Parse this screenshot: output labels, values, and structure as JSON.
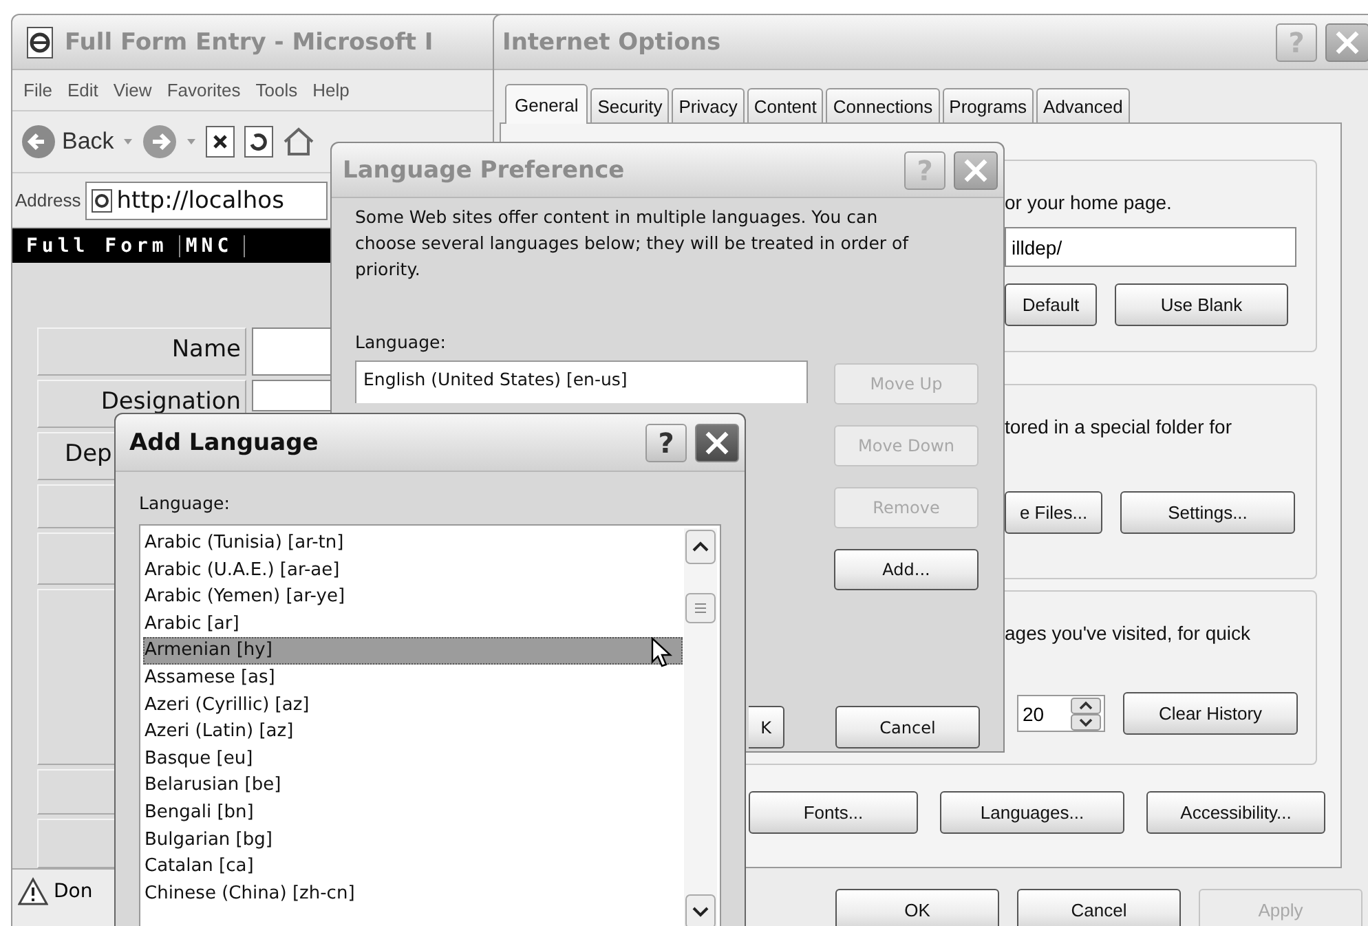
{
  "browser": {
    "title": "Full Form Entry - Microsoft I",
    "active": false,
    "menu": [
      "File",
      "Edit",
      "View",
      "Favorites",
      "Tools",
      "Help"
    ],
    "back_label": "Back",
    "address": {
      "label": "Address",
      "value": "http://localhos"
    },
    "nav": [
      "Full Form",
      "MNC"
    ],
    "form_labels": [
      {
        "label": "Name",
        "truncated": false
      },
      {
        "label": "Designation",
        "truncated": false
      },
      {
        "label": "Dep",
        "truncated": true
      }
    ],
    "status": "Don"
  },
  "internet_options": {
    "title": "Internet Options",
    "active": false,
    "help_button": "?",
    "tabs": [
      {
        "label": "General",
        "selected": true
      },
      {
        "label": "Security",
        "selected": false
      },
      {
        "label": "Privacy",
        "selected": false
      },
      {
        "label": "Content",
        "selected": false
      },
      {
        "label": "Connections",
        "selected": false
      },
      {
        "label": "Programs",
        "selected": false
      },
      {
        "label": "Advanced",
        "selected": false
      }
    ],
    "home_page": {
      "text": "or your home page.",
      "value": "illdep/",
      "buttons": [
        "Default",
        "Use Blank"
      ]
    },
    "temporary_files": {
      "text": "tored in a special folder for",
      "buttons": [
        "e Files...",
        "Settings..."
      ]
    },
    "history": {
      "text": "ages you've visited, for quick",
      "days": "20",
      "buttons": [
        "Clear History"
      ]
    },
    "bottom_buttons": [
      "Fonts...",
      "Languages...",
      "Accessibility..."
    ],
    "dialog_buttons": [
      {
        "label": "OK",
        "disabled": false
      },
      {
        "label": "Cancel",
        "disabled": false
      },
      {
        "label": "Apply",
        "disabled": true
      }
    ]
  },
  "language_preference": {
    "title": "Language Preference",
    "active": false,
    "help_button": "?",
    "description": "Some Web sites offer content in multiple languages. You can choose several languages below; they will be treated in order of priority.",
    "list_label": "Language:",
    "languages": [
      {
        "label": "English (United States) [en-us]",
        "selected": false
      }
    ],
    "side_buttons": [
      {
        "label": "Move Up",
        "disabled": true
      },
      {
        "label": "Move Down",
        "disabled": true
      },
      {
        "label": "Remove",
        "disabled": true
      },
      {
        "label": "Add...",
        "disabled": false
      }
    ],
    "buttons": [
      {
        "label": "K",
        "disabled": false
      },
      {
        "label": "Cancel",
        "disabled": false
      }
    ]
  },
  "add_language": {
    "title": "Add Language",
    "active": true,
    "help_button": "?",
    "list_label": "Language:",
    "languages": [
      {
        "label": "Arabic (Tunisia) [ar-tn]",
        "selected": false
      },
      {
        "label": "Arabic (U.A.E.) [ar-ae]",
        "selected": false
      },
      {
        "label": "Arabic (Yemen) [ar-ye]",
        "selected": false
      },
      {
        "label": "Arabic [ar]",
        "selected": false
      },
      {
        "label": "Armenian [hy]",
        "selected": true
      },
      {
        "label": "Assamese [as]",
        "selected": false
      },
      {
        "label": "Azeri (Cyrillic) [az]",
        "selected": false
      },
      {
        "label": "Azeri (Latin) [az]",
        "selected": false
      },
      {
        "label": "Basque [eu]",
        "selected": false
      },
      {
        "label": "Belarusian [be]",
        "selected": false
      },
      {
        "label": "Bengali [bn]",
        "selected": false
      },
      {
        "label": "Bulgarian [bg]",
        "selected": false
      },
      {
        "label": "Catalan [ca]",
        "selected": false
      },
      {
        "label": "Chinese (China) [zh-cn]",
        "selected": false
      }
    ]
  }
}
